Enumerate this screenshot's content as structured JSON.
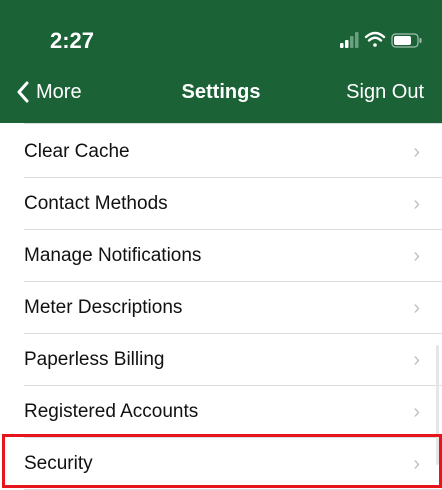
{
  "status_bar": {
    "time": "2:27",
    "signal_icon": "cellular-signal-icon",
    "wifi_icon": "wifi-icon",
    "battery_icon": "battery-icon"
  },
  "nav": {
    "back_label": "More",
    "title": "Settings",
    "action_label": "Sign Out",
    "back_icon": "chevron-left-icon"
  },
  "settings": {
    "items": [
      {
        "label": "Clear Cache"
      },
      {
        "label": "Contact Methods"
      },
      {
        "label": "Manage Notifications"
      },
      {
        "label": "Meter Descriptions"
      },
      {
        "label": "Paperless Billing"
      },
      {
        "label": "Registered Accounts"
      },
      {
        "label": "Security"
      }
    ],
    "chevron": "›"
  },
  "colors": {
    "header": "#1b6337",
    "highlight": "#e8141c"
  }
}
